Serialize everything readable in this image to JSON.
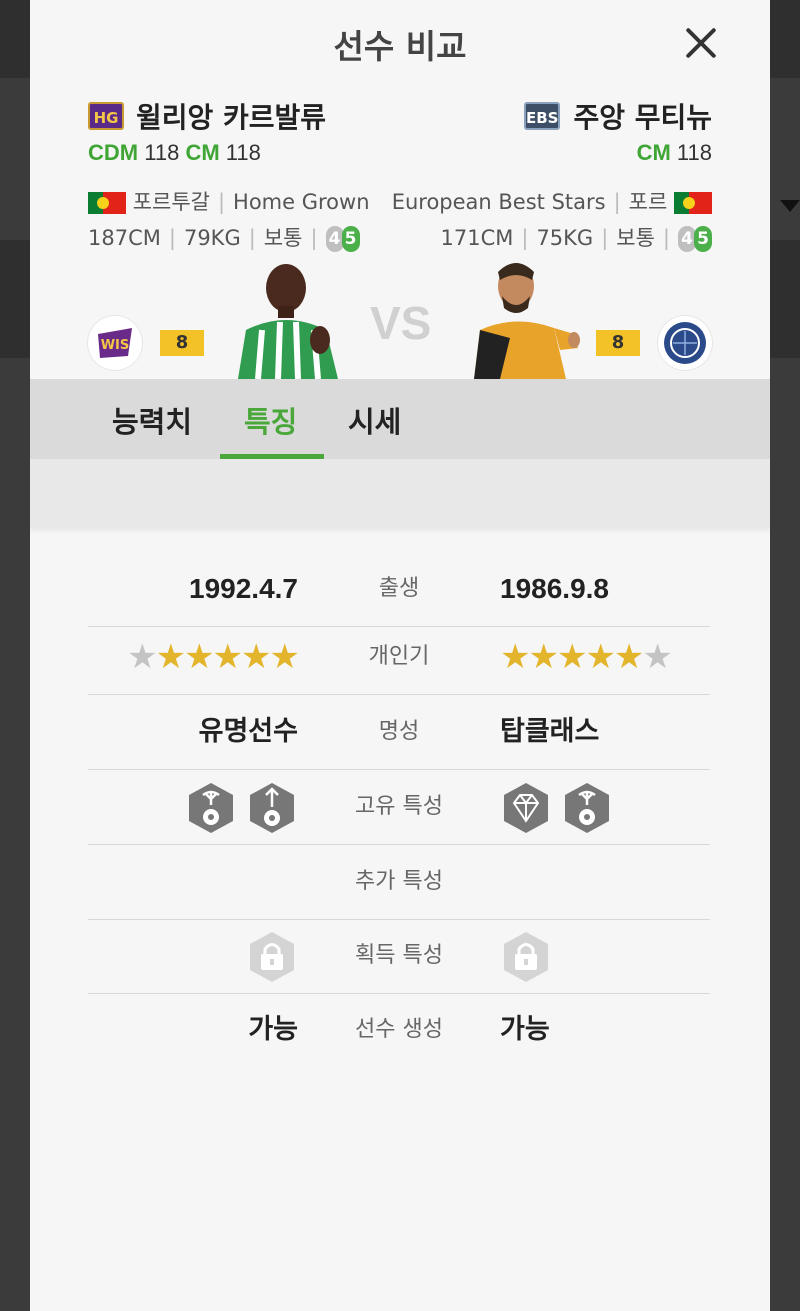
{
  "modal": {
    "title": "선수 비교",
    "close_icon": "close-icon"
  },
  "player_left": {
    "season_badge": "HG",
    "name": "윌리앙 카르발류",
    "positions": [
      {
        "code": "CDM",
        "ovr": "118"
      },
      {
        "code": "CM",
        "ovr": "118"
      }
    ],
    "nation": "포르투갈",
    "season_name": "Home Grown",
    "height": "187CM",
    "weight": "79KG",
    "body": "보통",
    "weak_foot": "4",
    "skill": "5",
    "grade": "8",
    "club_icon": "club-crest-icon"
  },
  "player_right": {
    "season_badge": "EBS",
    "name": "주앙 무티뉴",
    "positions": [
      {
        "code": "CM",
        "ovr": "118"
      }
    ],
    "nation": "포르",
    "season_name": "European Best Stars",
    "height": "171CM",
    "weight": "75KG",
    "body": "보통",
    "weak_foot": "4",
    "skill": "5",
    "grade": "8",
    "club_icon": "club-crest-icon"
  },
  "vs_label": "VS",
  "tabs": [
    {
      "label": "능력치",
      "active": false
    },
    {
      "label": "특징",
      "active": true
    },
    {
      "label": "시세",
      "active": false
    }
  ],
  "colors": {
    "accent": "#4aa83b",
    "star": "#e3b52c",
    "grade": "#f3c226"
  },
  "compare": {
    "birth": {
      "label": "출생",
      "left": "1992.4.7",
      "right": "1986.9.8"
    },
    "popularity": {
      "label": "개인기",
      "left_stars": 5,
      "right_stars": 5,
      "max": 6
    },
    "reputation": {
      "label": "명성",
      "left": "유명선수",
      "right": "탑클래스"
    },
    "unique_traits": {
      "label": "고유 특성",
      "left_icons": [
        "palm-ball-trait-icon",
        "arrow-ball-trait-icon"
      ],
      "right_icons": [
        "diamond-trait-icon",
        "palm-ball-trait-icon"
      ]
    },
    "extra_traits": {
      "label": "추가 특성"
    },
    "acquired_traits": {
      "label": "획득 특성",
      "left_icon": "lock-icon",
      "right_icon": "lock-icon"
    },
    "creation": {
      "label": "선수 생성",
      "left": "가능",
      "right": "가능"
    }
  }
}
